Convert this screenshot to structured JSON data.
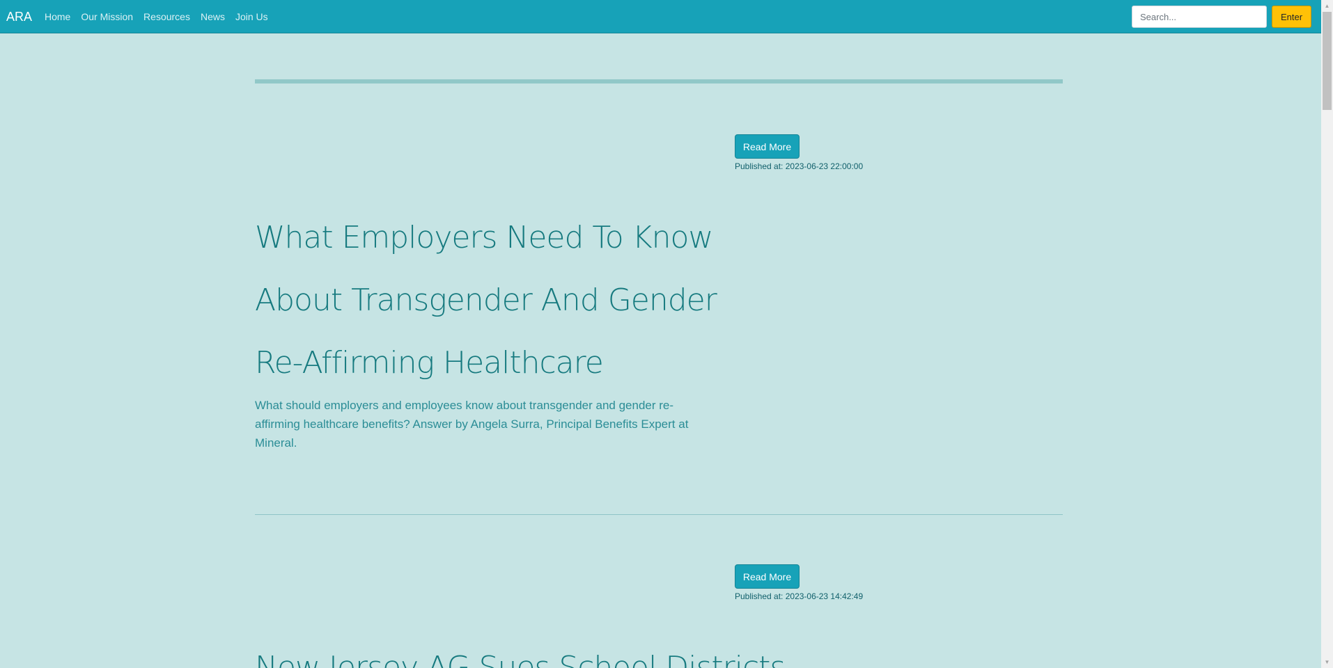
{
  "navbar": {
    "brand": "ARA",
    "links": [
      "Home",
      "Our Mission",
      "Resources",
      "News",
      "Join Us"
    ],
    "search_placeholder": "Search...",
    "enter_label": "Enter"
  },
  "articles": [
    {
      "read_more_label": "Read More",
      "published": "Published at: 2023-06-23 22:00:00",
      "title": "What Employers Need To Know About Transgender And Gender Re-Affirming Healthcare",
      "summary": "What should employers and employees know about transgender and gender re-affirming healthcare benefits? Answer by Angela Surra, Principal Benefits Expert at Mineral."
    },
    {
      "read_more_label": "Read More",
      "published": "Published at: 2023-06-23 14:42:49",
      "title": "New Jersey AG Sues School Districts"
    }
  ],
  "colors": {
    "background": "#c6e4e4",
    "navbar": "#17a2b8",
    "accent_button": "#ffc107",
    "title_text": "#167a7f"
  }
}
